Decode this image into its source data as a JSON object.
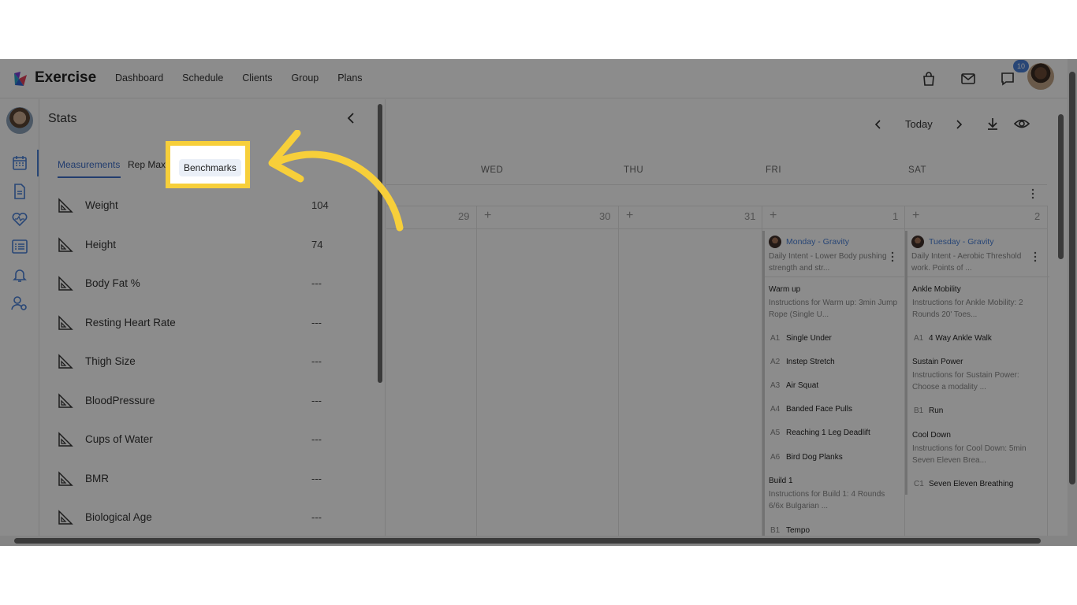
{
  "app": {
    "brand": "Exercise"
  },
  "nav": {
    "links": [
      "Dashboard",
      "Schedule",
      "Clients",
      "Group",
      "Plans"
    ]
  },
  "top_icons": [
    "shopping-bag-icon",
    "mail-icon",
    "chat-icon"
  ],
  "notifications": {
    "count": "10"
  },
  "rail": {
    "icons": [
      "calendar-icon",
      "document-icon",
      "heart-pulse-icon",
      "list-icon",
      "bell-icon",
      "user-settings-icon"
    ]
  },
  "stats": {
    "title": "Stats",
    "tabs": [
      "Measurements",
      "Rep Maxes",
      "Benchmarks"
    ],
    "active_tab": "Measurements",
    "metrics": [
      {
        "label": "Weight",
        "value": "104"
      },
      {
        "label": "Height",
        "value": "74"
      },
      {
        "label": "Body Fat %",
        "value": "---"
      },
      {
        "label": "Resting Heart Rate",
        "value": "---"
      },
      {
        "label": "Thigh Size",
        "value": "---"
      },
      {
        "label": "BloodPressure",
        "value": "---"
      },
      {
        "label": "Cups of Water",
        "value": "---"
      },
      {
        "label": "BMR",
        "value": "---"
      },
      {
        "label": "Biological Age",
        "value": "---"
      }
    ]
  },
  "calendar": {
    "today_label": "Today",
    "days": [
      "WED",
      "THU",
      "FRI",
      "SAT"
    ],
    "dates": [
      "29",
      "30",
      "31",
      "1",
      "2"
    ],
    "friday": {
      "session": "Monday - Gravity",
      "intent": "Daily Intent - Lower Body pushing strength and str...",
      "blocks": [
        {
          "title": "Warm up",
          "note": "Instructions for Warm up: 3min Jump Rope (Single U...",
          "items": [
            [
              "A1",
              "Single Under"
            ],
            [
              "A2",
              "Instep Stretch"
            ],
            [
              "A3",
              "Air Squat"
            ],
            [
              "A4",
              "Banded Face Pulls"
            ],
            [
              "A5",
              "Reaching 1 Leg Deadlift"
            ],
            [
              "A6",
              "Bird Dog Planks"
            ]
          ]
        },
        {
          "title": "Build 1",
          "note": "Instructions for Build 1: 4 Rounds 6/6x Bulgarian ...",
          "items": [
            [
              "B1",
              "Tempo"
            ]
          ]
        }
      ]
    },
    "saturday": {
      "session": "Tuesday - Gravity",
      "intent": "Daily Intent - Aerobic Threshold work. Points of ...",
      "blocks": [
        {
          "title": "Ankle Mobility",
          "note": "Instructions for Ankle Mobility: 2 Rounds 20' Toes...",
          "items": [
            [
              "A1",
              "4 Way Ankle Walk"
            ]
          ]
        },
        {
          "title": "Sustain Power",
          "note": "Instructions for Sustain Power: Choose a modality ...",
          "items": [
            [
              "B1",
              "Run"
            ]
          ]
        },
        {
          "title": "Cool Down",
          "note": "Instructions for Cool Down: 5min Seven Eleven Brea...",
          "items": [
            [
              "C1",
              "Seven Eleven Breathing"
            ]
          ]
        }
      ]
    }
  },
  "callout": {
    "label": "Benchmarks",
    "color": "#f7cf3a"
  }
}
